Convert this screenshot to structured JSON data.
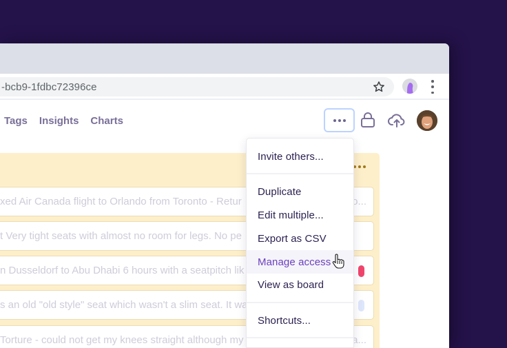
{
  "browser": {
    "url": "-bcb9-1fdbc72396ce",
    "bookmark_icon": "star-icon",
    "profile_icon": "profile-avatar-icon",
    "menu_icon": "vertical-dots-icon"
  },
  "nav": {
    "items": [
      {
        "label": "Tags"
      },
      {
        "label": "Insights"
      },
      {
        "label": "Charts"
      }
    ]
  },
  "header_actions": {
    "more_icon": "horizontal-dots-icon",
    "lock_icon": "lock-icon",
    "upload_icon": "cloud-upload-icon",
    "avatar": "user-avatar"
  },
  "cards": [
    {
      "text": "xed Air Canada flight to Orlando from Toronto - Retur",
      "tail": "o...",
      "tag_color": null
    },
    {
      "text": "t Very tight seats with almost no room for legs. No pe",
      "tail": "",
      "tag_color": null
    },
    {
      "text": "n Dusseldorf to Abu Dhabi 6 hours with a seatpitch lik",
      "tail": "",
      "tag_color": "#f0456d"
    },
    {
      "text": "s an old \"old style\" seat which wasn't a slim seat. It wa",
      "tail": "",
      "tag_color": "#dde6fc"
    },
    {
      "text": "Torture - could not get my knees straight although my",
      "tail": "a...",
      "tag_color": null
    }
  ],
  "menu": {
    "items": [
      {
        "label": "Invite others..."
      },
      {
        "label": "Duplicate"
      },
      {
        "label": "Edit multiple..."
      },
      {
        "label": "Export as CSV"
      },
      {
        "label": "Manage access",
        "hovered": true
      },
      {
        "label": "View as board"
      },
      {
        "label": "Shortcuts..."
      }
    ]
  },
  "colors": {
    "background": "#24124a",
    "accent": "#6a3fbd",
    "column": "#fdefc9",
    "focus_ring": "#bcd3ff"
  }
}
